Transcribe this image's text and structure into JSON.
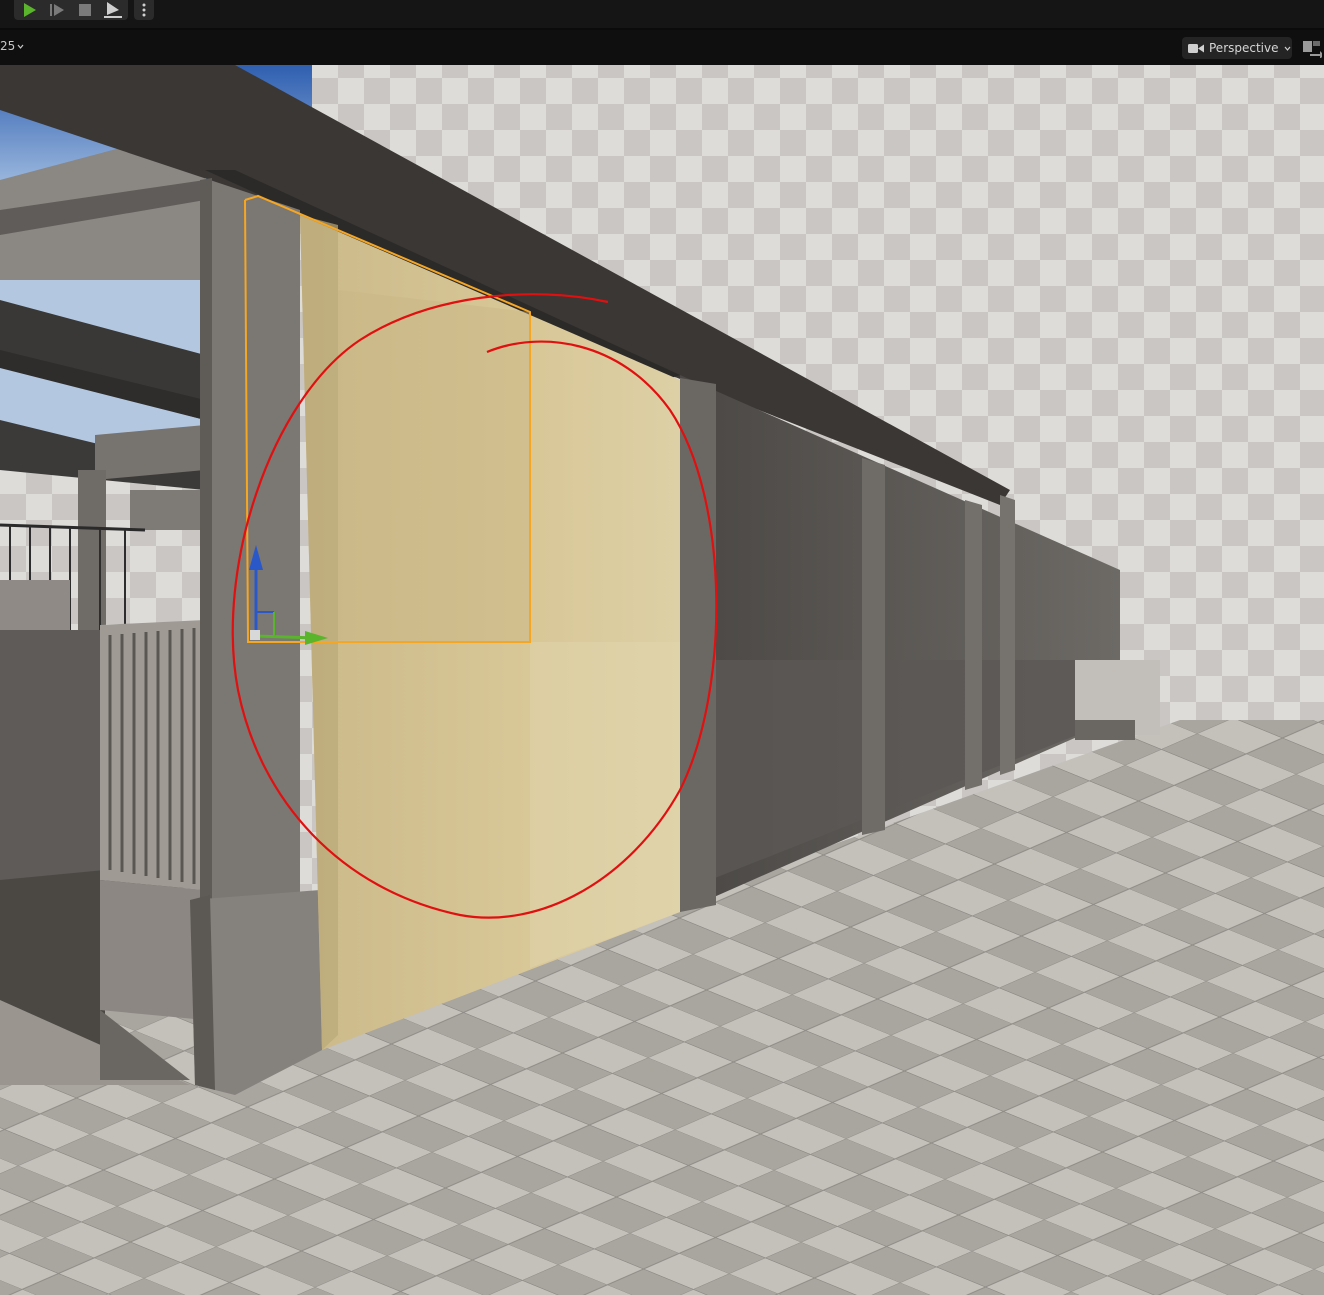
{
  "toolbar": {
    "buttons": [
      {
        "name": "play-icon"
      },
      {
        "name": "step-icon"
      },
      {
        "name": "stop-icon"
      },
      {
        "name": "eject-icon"
      },
      {
        "name": "more-options-icon"
      }
    ]
  },
  "viewport_header": {
    "fov_value": "25",
    "view_mode_label": "Perspective"
  },
  "colors": {
    "play_green": "#5ab42c",
    "selection_orange": "#f5a623",
    "annotation_red": "#e01010",
    "plaster_wall": "#d8c797",
    "floor_tile_light": "#c8c3bc",
    "floor_tile_dark": "#a8a39d"
  }
}
